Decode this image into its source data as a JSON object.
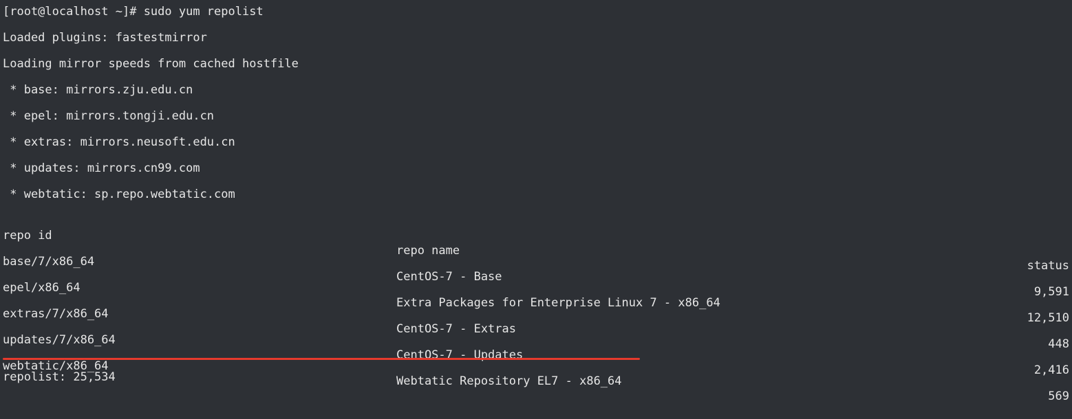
{
  "terminal": {
    "prompt_line": "[root@localhost ~]# sudo yum repolist",
    "plugins_line": "Loaded plugins: fastestmirror",
    "mirror_speed_line": "Loading mirror speeds from cached hostfile",
    "mirrors": [
      " * base: mirrors.zju.edu.cn",
      " * epel: mirrors.tongji.edu.cn",
      " * extras: mirrors.neusoft.edu.cn",
      " * updates: mirrors.cn99.com",
      " * webtatic: sp.repo.webtatic.com"
    ],
    "table": {
      "headers": {
        "id": "repo id",
        "name": "repo name",
        "status": "status"
      },
      "rows": [
        {
          "id": "base/7/x86_64",
          "name": "CentOS-7 - Base",
          "status": "9,591"
        },
        {
          "id": "epel/x86_64",
          "name": "Extra Packages for Enterprise Linux 7 - x86_64",
          "status": "12,510"
        },
        {
          "id": "extras/7/x86_64",
          "name": "CentOS-7 - Extras",
          "status": "448"
        },
        {
          "id": "updates/7/x86_64",
          "name": "CentOS-7 - Updates",
          "status": "2,416"
        },
        {
          "id": "webtatic/x86_64",
          "name": "Webtatic Repository EL7 - x86_64",
          "status": "569"
        }
      ]
    },
    "summary_line": "repolist: 25,534",
    "highlight_color": "#e63a2c",
    "background_color": "#2d3035",
    "text_color": "#e6e6e6"
  }
}
